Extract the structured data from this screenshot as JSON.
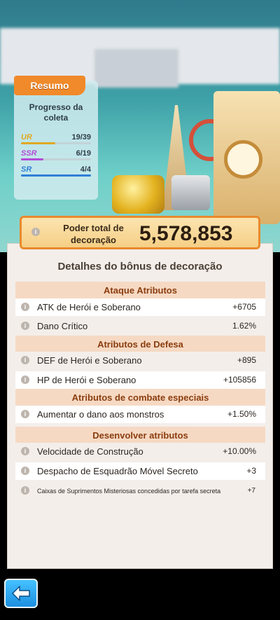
{
  "summary": {
    "tab_label": "Resumo",
    "title": "Progresso da coleta",
    "rarities": [
      {
        "tag": "UR",
        "count": "19/39",
        "progress": 0.49,
        "color": "#e0a823"
      },
      {
        "tag": "SSR",
        "count": "6/19",
        "progress": 0.32,
        "color": "#b24bd6"
      },
      {
        "tag": "SR",
        "count": "4/4",
        "progress": 1.0,
        "color": "#2f7fd6"
      }
    ]
  },
  "power": {
    "label": "Poder total de decoração",
    "value": "5,578,853"
  },
  "details": {
    "title": "Detalhes do bônus de decoração",
    "sections": [
      {
        "header": "Ataque Atributos",
        "rows": [
          {
            "label": "ATK de Herói e Soberano",
            "value": "+6705"
          },
          {
            "label": "Dano Crítico",
            "value": "1.62%"
          }
        ]
      },
      {
        "header": "Atributos de Defesa",
        "rows": [
          {
            "label": "DEF de Herói e Soberano",
            "value": "+895"
          },
          {
            "label": "HP de Herói e Soberano",
            "value": "+105856"
          }
        ]
      },
      {
        "header": "Atributos de combate especiais",
        "rows": [
          {
            "label": "Aumentar o dano aos monstros",
            "value": "+1.50%"
          }
        ]
      },
      {
        "header": "Desenvolver atributos",
        "rows": [
          {
            "label": "Velocidade de Construção",
            "value": "+10.00%"
          },
          {
            "label": "Despacho de Esquadrão Móvel Secreto",
            "value": "+3"
          },
          {
            "label": "Caixas de Suprimentos Misteriosas concedidas por tarefa secreta",
            "value": "+7"
          }
        ]
      }
    ]
  },
  "nav": {
    "back_icon": "arrow-left-icon"
  }
}
